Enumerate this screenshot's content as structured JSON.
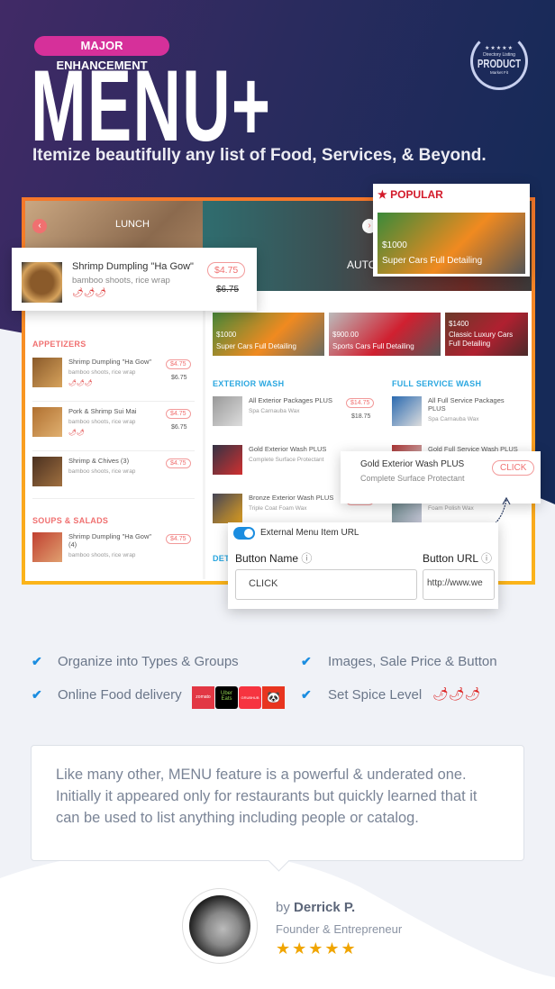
{
  "badge": "MAJOR ENHANCEMENT",
  "title": "MENU+",
  "subtitle": "Itemize beautifully any list of Food, Services, & Beyond.",
  "seal": {
    "stars": "★★★★★",
    "line1": "Directory Listing",
    "line2": "PRODUCT",
    "line3": "Market Fit"
  },
  "colors": {
    "accent_pink": "#d6309a",
    "frame_orange": "#f5772a",
    "price_red": "#f07070",
    "section_blue": "#2aa7e0",
    "check_blue": "#1b8de0",
    "star_gold": "#f0a500"
  },
  "lunch": {
    "label": "LUNCH",
    "auto_label": "AUTO",
    "sections": [
      {
        "title": "APPETIZERS"
      },
      {
        "title": "SOUPS & SALADS"
      }
    ],
    "items": [
      {
        "name": "Shrimp Dumpling \"Ha Gow\"",
        "desc": "bamboo shoots, rice wrap",
        "price": "$4.75",
        "old": "$6.75",
        "spice": "🌶🌶🌶"
      },
      {
        "name": "Pork & Shrimp Sui Mai",
        "desc": "bamboo shoots, rice wrap",
        "price": "$4.75",
        "old": "$6.75",
        "spice": "🌶🌶"
      },
      {
        "name": "Shrimp & Chives (3)",
        "desc": "bamboo shoots, rice wrap",
        "price": "$4.75"
      },
      {
        "name": "Shrimp Dumpling \"Ha Gow\" (4)",
        "desc": "bamboo shoots, rice wrap",
        "price": "$4.75"
      }
    ]
  },
  "auto": {
    "cars": [
      {
        "price": "$1000",
        "name": "Super Cars Full Detailing"
      },
      {
        "price": "$900.00",
        "name": "Sports Cars Full Detailing"
      },
      {
        "price": "$1400",
        "name": "Classic Luxury Cars Full Detailing"
      }
    ],
    "exterior": {
      "title": "EXTERIOR WASH",
      "items": [
        {
          "name": "All Exterior Packages PLUS",
          "desc": "Spa Carnauba Wax",
          "price": "$14.75",
          "old": "$18.75"
        },
        {
          "name": "Gold Exterior Wash PLUS",
          "desc": "Complete Surface Protectant"
        },
        {
          "name": "Bronze Exterior Wash PLUS",
          "desc": "Triple Coat Foam Wax",
          "price": "$44.75"
        }
      ]
    },
    "full": {
      "title": "FULL SERVICE WASH",
      "items": [
        {
          "name": "All Full Service Packages PLUS",
          "desc": "Spa Carnauba Wax"
        },
        {
          "name": "Gold Full Service Wash PLUS",
          "desc": ""
        },
        {
          "name": "",
          "desc": "Foam Polish Wax"
        }
      ]
    },
    "details_title": "DET"
  },
  "popup_item": {
    "name": "Shrimp Dumpling \"Ha Gow\"",
    "desc": "bamboo shoots, rice wrap",
    "price": "$4.75",
    "old": "$6.75",
    "spice": "🌶🌶🌶"
  },
  "popular": {
    "label": "POPULAR",
    "price": "$1000",
    "name": "Super Cars Full Detailing"
  },
  "click_card": {
    "name": "Gold Exterior Wash PLUS",
    "desc": "Complete Surface Protectant",
    "button": "CLICK"
  },
  "form": {
    "toggle_label": "External Menu Item URL",
    "toggle_on": true,
    "button_name_label": "Button Name",
    "button_name_value": "CLICK",
    "button_url_label": "Button URL",
    "button_url_value": "http://www.we"
  },
  "features": [
    {
      "text": "Organize into Types & Groups"
    },
    {
      "text": "Images, Sale Price & Button"
    },
    {
      "text": "Online Food delivery",
      "logos": [
        "zomato",
        "Uber Eats",
        "GRUBHUB",
        "foodpanda"
      ]
    },
    {
      "text": "Set Spice Level",
      "spice": "🌶🌶🌶"
    }
  ],
  "testimonial": {
    "quote": "Like many other, MENU feature is a powerful & underated one. Initially it appeared only for restaurants but quickly learned that it can be used to list anything including people or catalog.",
    "by": "by",
    "name": "Derrick P.",
    "role": "Founder & Entrepreneur",
    "stars": "★★★★★",
    "rating": 5
  }
}
